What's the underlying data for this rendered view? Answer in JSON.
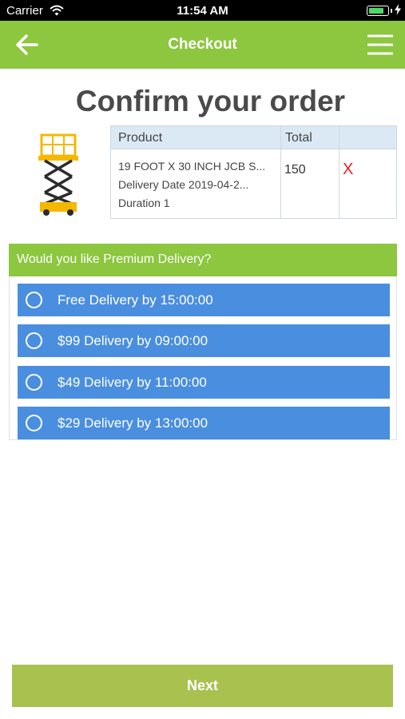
{
  "status_bar": {
    "carrier": "Carrier",
    "time": "11:54 AM",
    "battery_level": 0.85
  },
  "nav": {
    "title": "Checkout",
    "back_icon": "arrow-left-icon",
    "menu_icon": "hamburger-menu-icon"
  },
  "heading": "Confirm your order",
  "order_table": {
    "headers": [
      "Product",
      "Total",
      ""
    ],
    "row": {
      "product_name": "19 FOOT X 30 INCH JCB S...",
      "delivery_date": "Delivery Date 2019-04-2...",
      "duration": "Duration 1",
      "total": "150",
      "remove": "X"
    }
  },
  "delivery": {
    "question": "Would you like Premium Delivery?",
    "options": [
      {
        "label": "Free Delivery by 15:00:00",
        "selected": false
      },
      {
        "label": "$99 Delivery by 09:00:00",
        "selected": false
      },
      {
        "label": "$49 Delivery by 11:00:00",
        "selected": false
      },
      {
        "label": "$29 Delivery by 13:00:00",
        "selected": false
      }
    ]
  },
  "next_button": "Next",
  "colors": {
    "brand_green": "#8dc63f",
    "option_blue": "#4a8ee0",
    "next_button": "#a8c14f",
    "remove_red": "#e02020"
  }
}
